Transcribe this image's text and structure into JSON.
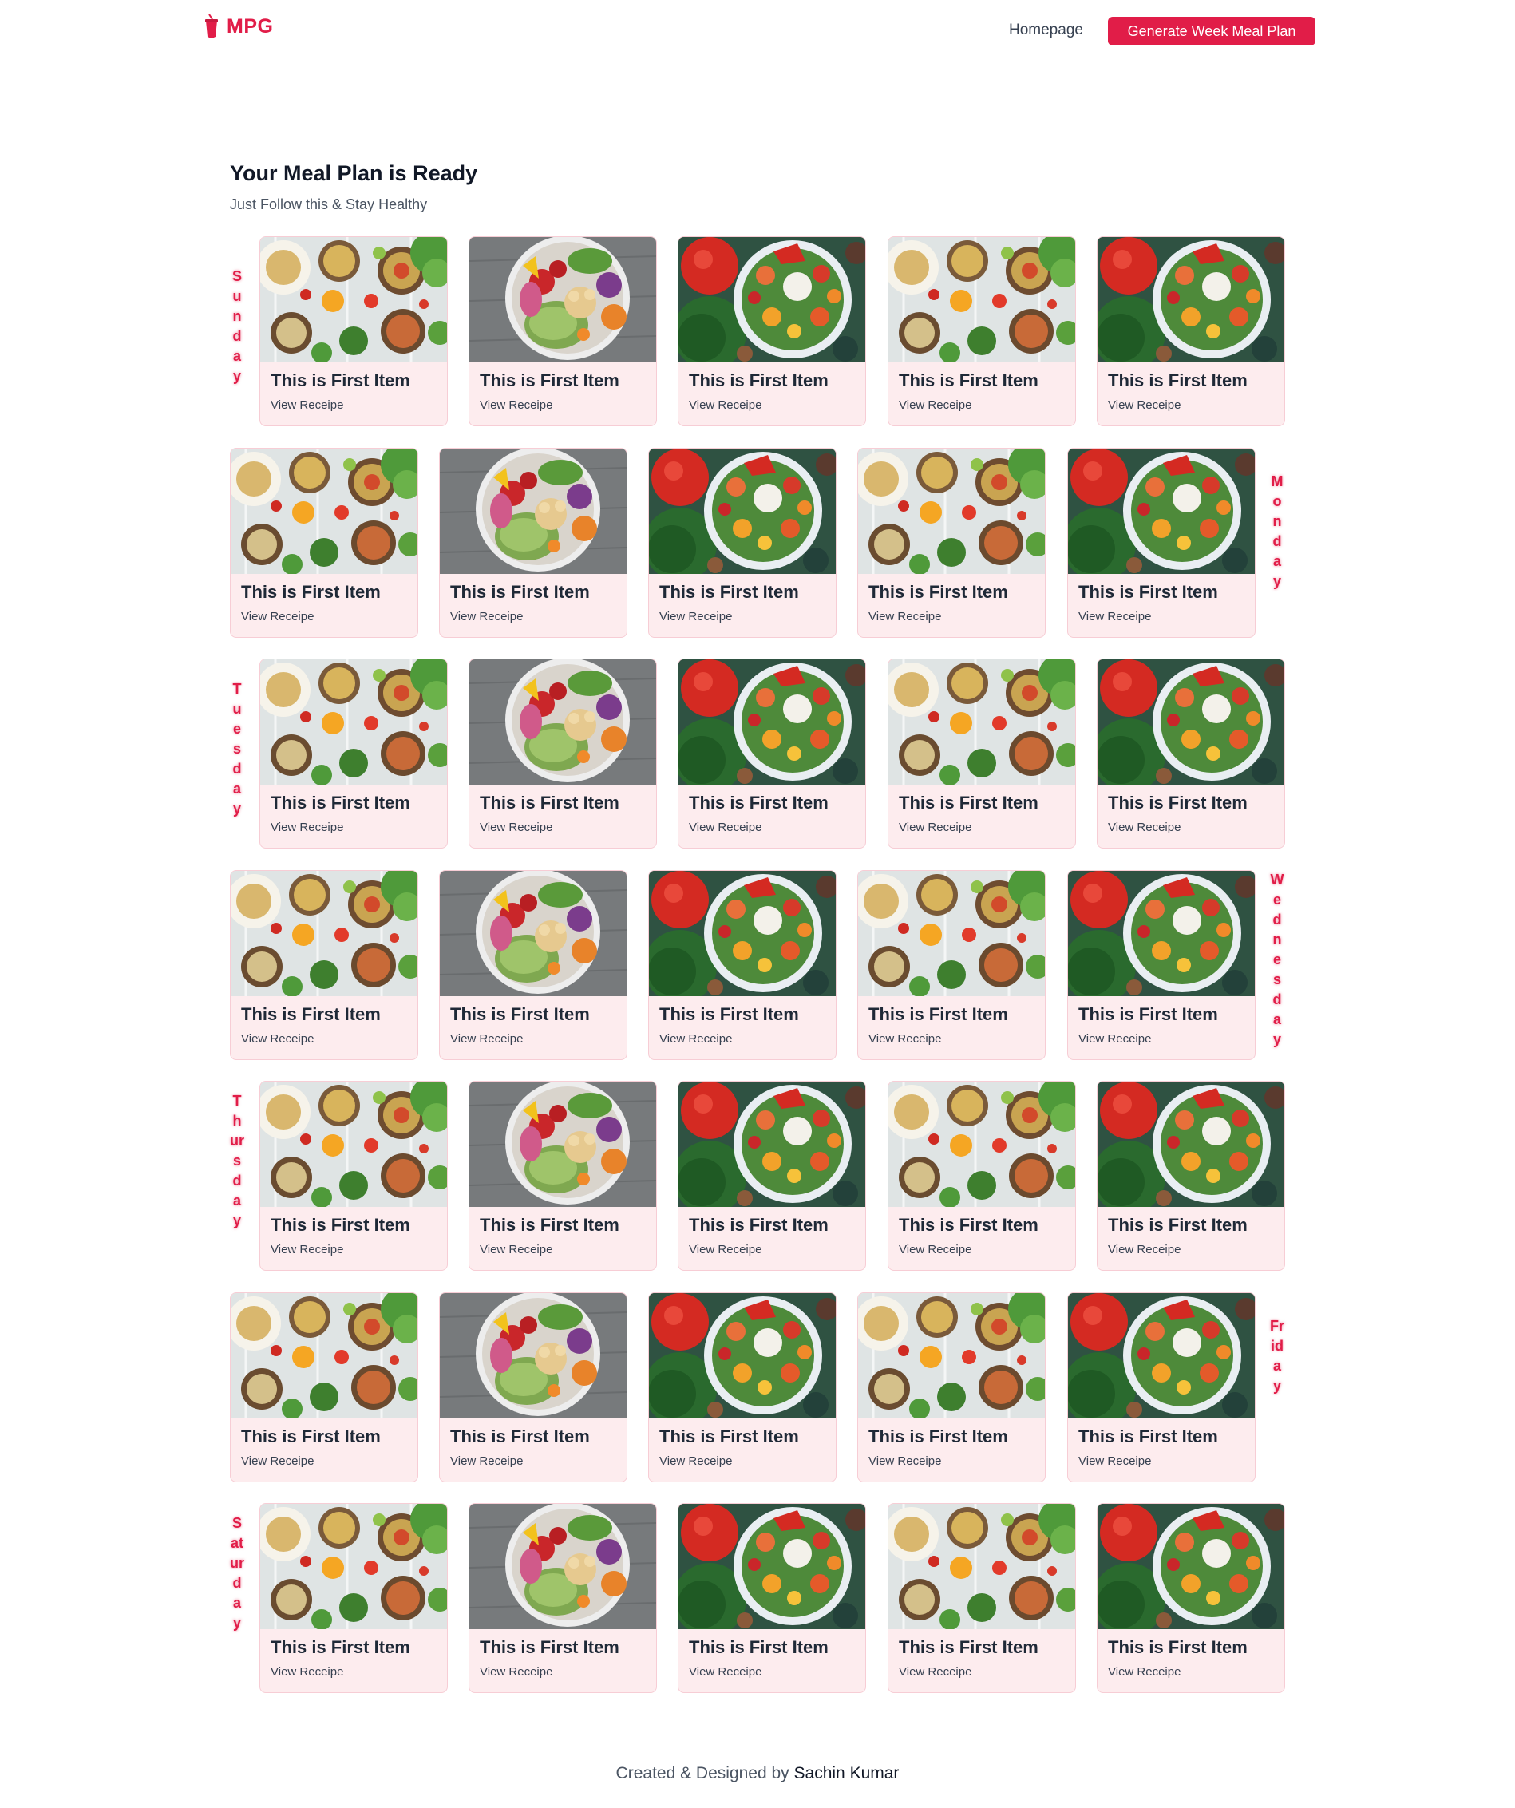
{
  "header": {
    "logo_text": "MPG",
    "nav_home": "Homepage",
    "nav_button": "Generate Week Meal Plan"
  },
  "intro": {
    "title": "Your Meal Plan is Ready",
    "subtitle": "Just Follow this & Stay Healthy"
  },
  "days": [
    {
      "label": "Sunday",
      "side": "left",
      "items": [
        {
          "title": "This is First Item",
          "link": "View Receipe",
          "image": "bowls-top-view"
        },
        {
          "title": "This is First Item",
          "link": "View Receipe",
          "image": "salad-bowl-wood"
        },
        {
          "title": "This is First Item",
          "link": "View Receipe",
          "image": "salad-plate-tomatoes"
        },
        {
          "title": "This is First Item",
          "link": "View Receipe",
          "image": "bowls-top-view"
        },
        {
          "title": "This is First Item",
          "link": "View Receipe",
          "image": "salad-plate-tomatoes"
        }
      ]
    },
    {
      "label": "Monday",
      "side": "right",
      "items": [
        {
          "title": "This is First Item",
          "link": "View Receipe",
          "image": "bowls-top-view"
        },
        {
          "title": "This is First Item",
          "link": "View Receipe",
          "image": "salad-bowl-wood"
        },
        {
          "title": "This is First Item",
          "link": "View Receipe",
          "image": "salad-plate-tomatoes"
        },
        {
          "title": "This is First Item",
          "link": "View Receipe",
          "image": "bowls-top-view"
        },
        {
          "title": "This is First Item",
          "link": "View Receipe",
          "image": "salad-plate-tomatoes"
        }
      ]
    },
    {
      "label": "Tuesday",
      "side": "left",
      "items": [
        {
          "title": "This is First Item",
          "link": "View Receipe",
          "image": "bowls-top-view"
        },
        {
          "title": "This is First Item",
          "link": "View Receipe",
          "image": "salad-bowl-wood"
        },
        {
          "title": "This is First Item",
          "link": "View Receipe",
          "image": "salad-plate-tomatoes"
        },
        {
          "title": "This is First Item",
          "link": "View Receipe",
          "image": "bowls-top-view"
        },
        {
          "title": "This is First Item",
          "link": "View Receipe",
          "image": "salad-plate-tomatoes"
        }
      ]
    },
    {
      "label": "Wednesday",
      "side": "right",
      "items": [
        {
          "title": "This is First Item",
          "link": "View Receipe",
          "image": "bowls-top-view"
        },
        {
          "title": "This is First Item",
          "link": "View Receipe",
          "image": "salad-bowl-wood"
        },
        {
          "title": "This is First Item",
          "link": "View Receipe",
          "image": "salad-plate-tomatoes"
        },
        {
          "title": "This is First Item",
          "link": "View Receipe",
          "image": "bowls-top-view"
        },
        {
          "title": "This is First Item",
          "link": "View Receipe",
          "image": "salad-plate-tomatoes"
        }
      ]
    },
    {
      "label": "Thursday",
      "side": "left",
      "items": [
        {
          "title": "This is First Item",
          "link": "View Receipe",
          "image": "bowls-top-view"
        },
        {
          "title": "This is First Item",
          "link": "View Receipe",
          "image": "salad-bowl-wood"
        },
        {
          "title": "This is First Item",
          "link": "View Receipe",
          "image": "salad-plate-tomatoes"
        },
        {
          "title": "This is First Item",
          "link": "View Receipe",
          "image": "bowls-top-view"
        },
        {
          "title": "This is First Item",
          "link": "View Receipe",
          "image": "salad-plate-tomatoes"
        }
      ]
    },
    {
      "label": "Friday",
      "side": "right",
      "items": [
        {
          "title": "This is First Item",
          "link": "View Receipe",
          "image": "bowls-top-view"
        },
        {
          "title": "This is First Item",
          "link": "View Receipe",
          "image": "salad-bowl-wood"
        },
        {
          "title": "This is First Item",
          "link": "View Receipe",
          "image": "salad-plate-tomatoes"
        },
        {
          "title": "This is First Item",
          "link": "View Receipe",
          "image": "bowls-top-view"
        },
        {
          "title": "This is First Item",
          "link": "View Receipe",
          "image": "salad-plate-tomatoes"
        }
      ]
    },
    {
      "label": "Saturday",
      "side": "left",
      "items": [
        {
          "title": "This is First Item",
          "link": "View Receipe",
          "image": "bowls-top-view"
        },
        {
          "title": "This is First Item",
          "link": "View Receipe",
          "image": "salad-bowl-wood"
        },
        {
          "title": "This is First Item",
          "link": "View Receipe",
          "image": "salad-plate-tomatoes"
        },
        {
          "title": "This is First Item",
          "link": "View Receipe",
          "image": "bowls-top-view"
        },
        {
          "title": "This is First Item",
          "link": "View Receipe",
          "image": "salad-plate-tomatoes"
        }
      ]
    }
  ],
  "footer": {
    "prefix": "Created & Designed by",
    "author": "Sachin Kumar"
  },
  "colors": {
    "accent": "#e11d48",
    "card_bg": "#fdecee",
    "card_border": "#f7cdd5"
  }
}
